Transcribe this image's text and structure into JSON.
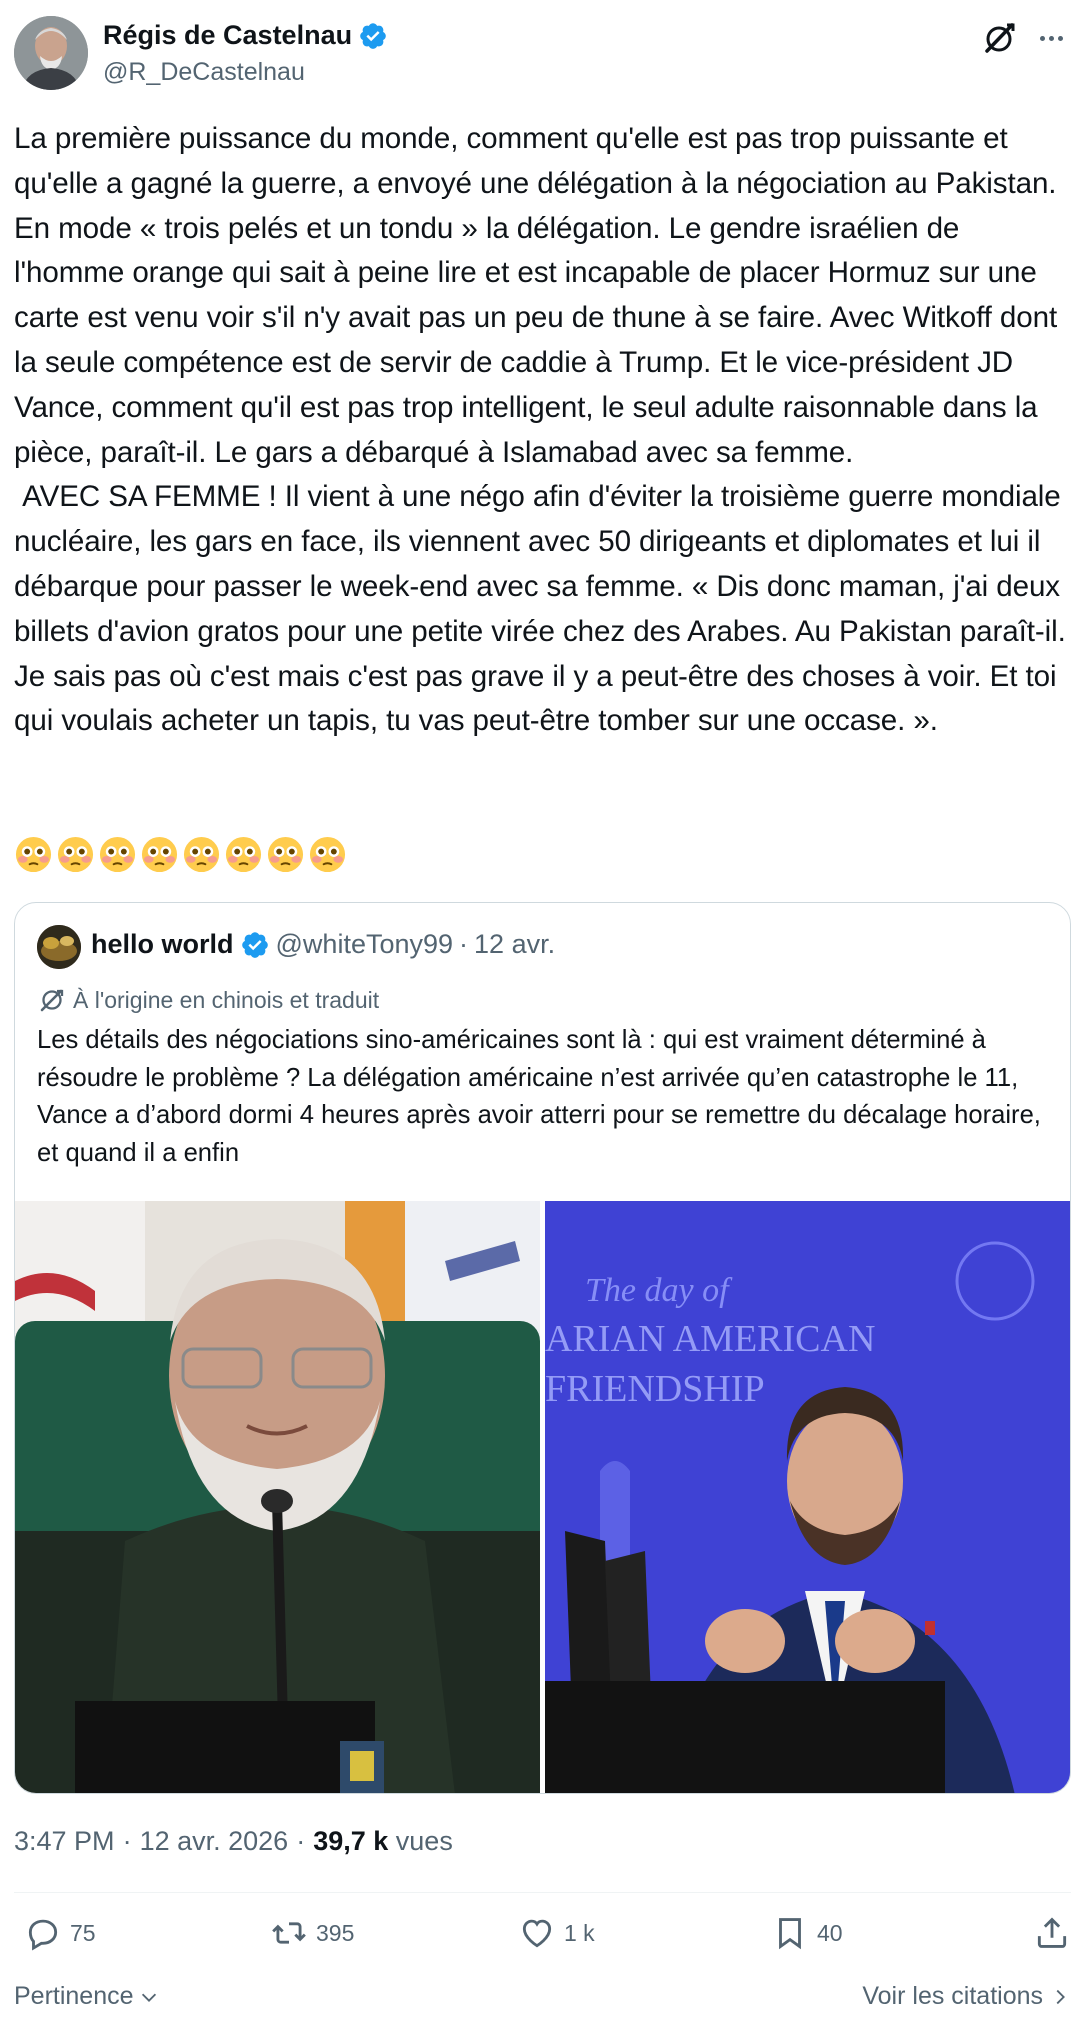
{
  "author": {
    "name": "Régis de Castelnau",
    "handle": "@R_DeCastelnau"
  },
  "tweet": {
    "text": "La première puissance du monde, comment qu'elle est pas trop puissante et qu'elle a gagné la guerre, a envoyé une délégation à la négociation au Pakistan. En mode « trois pelés et un tondu » la délégation. Le gendre israélien de l'homme orange qui sait à peine lire et est incapable de placer Hormuz sur une carte est venu voir s'il n'y avait pas un peu de thune à se faire. Avec Witkoff dont la seule compétence est de servir de caddie à Trump. Et le vice-président JD Vance, comment qu'il est pas trop intelligent, le seul adulte raisonnable dans la pièce, paraît-il. Le gars a débarqué à Islamabad avec sa femme.\n AVEC SA FEMME ! Il vient à une négo afin d'éviter la troisième guerre mondiale nucléaire, les gars en face, ils viennent avec 50 dirigeants et diplomates et lui il débarque pour passer le week-end avec sa femme. « Dis donc maman, j'ai deux billets d'avion gratos pour une petite virée chez des Arabes. Au Pakistan paraît-il. Je sais pas où c'est mais c'est pas grave il y a peut-être des choses à voir. Et toi qui voulais acheter un tapis, tu vas peut-être tomber sur une occase. ».",
    "emoji_count": 8,
    "emoji_name": "flushed-face-icon"
  },
  "quote": {
    "name": "hello world",
    "handle": "@whiteTony99",
    "separator": "·",
    "date": "12 avr.",
    "translated_label": "À l'origine en chinois et traduit",
    "text": "Les détails des négociations sino-américaines sont là : qui est vraiment déterminé à résoudre le problème ? La délégation américaine n’est arrivée qu’en catastrophe le 11, Vance a d’abord dormi 4 heures après avoir atterri pour se remettre du décalage horaire, et quand il a enfin",
    "images": [
      "photo-man-green-uniform",
      "photo-speaker-blue-backdrop"
    ],
    "backdrop_text": [
      "The day of",
      "ARIAN AMERICAN",
      "FRIENDSHIP"
    ]
  },
  "meta": {
    "time": "3:47 PM",
    "date": "12 avr. 2026",
    "separator": "·",
    "views_count": "39,7 k",
    "views_label": "vues"
  },
  "actions": {
    "replies": "75",
    "reposts": "395",
    "likes": "1 k",
    "bookmarks": "40"
  },
  "footer": {
    "sort_label": "Pertinence",
    "quotes_label": "Voir les citations"
  },
  "colors": {
    "text": "#0f1419",
    "secondary": "#536471",
    "verified": "#1d9bf0",
    "border": "#cfd9de"
  }
}
